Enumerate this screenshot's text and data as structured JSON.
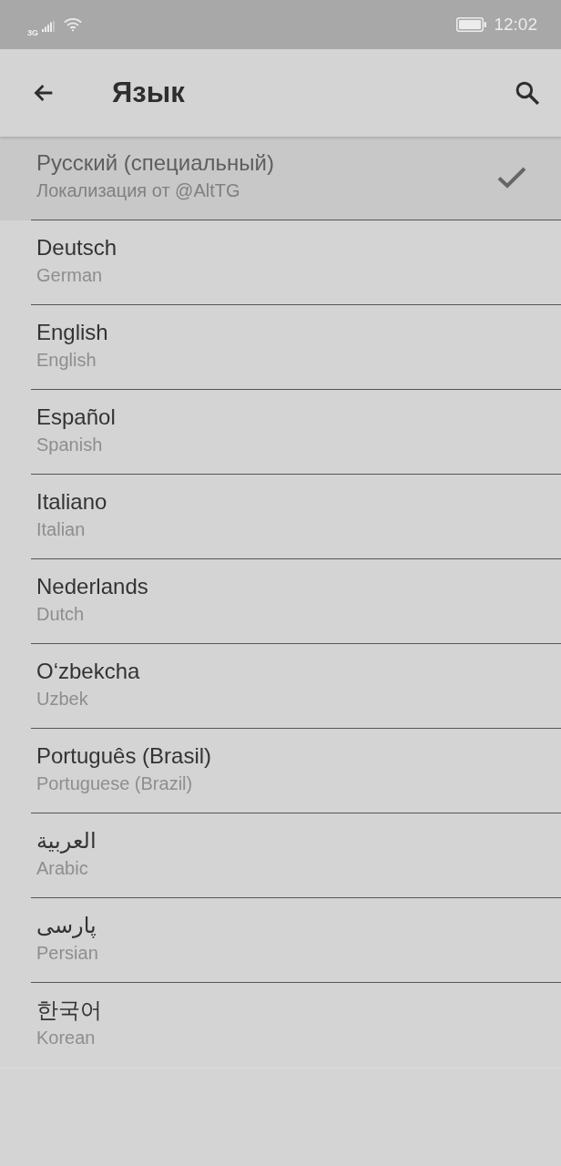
{
  "status_bar": {
    "network": "3G",
    "time": "12:02"
  },
  "app_bar": {
    "title": "Язык"
  },
  "languages": [
    {
      "name": "Русский (специальный)",
      "subtitle": "Локализация от @AltTG",
      "selected": true
    },
    {
      "name": "Deutsch",
      "subtitle": "German",
      "selected": false
    },
    {
      "name": "English",
      "subtitle": "English",
      "selected": false
    },
    {
      "name": "Español",
      "subtitle": "Spanish",
      "selected": false
    },
    {
      "name": "Italiano",
      "subtitle": "Italian",
      "selected": false
    },
    {
      "name": "Nederlands",
      "subtitle": "Dutch",
      "selected": false
    },
    {
      "name": "O‘zbekcha",
      "subtitle": "Uzbek",
      "selected": false
    },
    {
      "name": "Português (Brasil)",
      "subtitle": "Portuguese (Brazil)",
      "selected": false
    },
    {
      "name": "العربية",
      "subtitle": "Arabic",
      "selected": false
    },
    {
      "name": "پارسی",
      "subtitle": "Persian",
      "selected": false
    },
    {
      "name": "한국어",
      "subtitle": "Korean",
      "selected": false
    }
  ]
}
